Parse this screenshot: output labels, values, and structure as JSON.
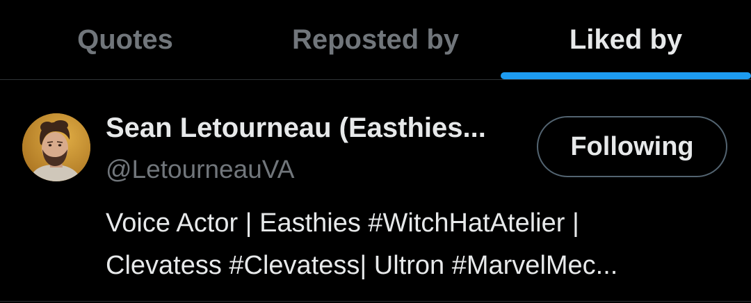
{
  "tabs": [
    {
      "label": "Quotes",
      "active": false
    },
    {
      "label": "Reposted by",
      "active": false
    },
    {
      "label": "Liked by",
      "active": true
    }
  ],
  "accent_color": "#1d9bf0",
  "user": {
    "display_name": "Sean Letourneau (Easthies...",
    "handle": "@LetourneauVA",
    "follow_button_label": "Following",
    "avatar_icon": "profile-photo",
    "bio_lines": [
      "Voice Actor | Easthies #WitchHatAtelier |",
      "Clevatess #Clevatess| Ultron #MarvelMec..."
    ]
  }
}
